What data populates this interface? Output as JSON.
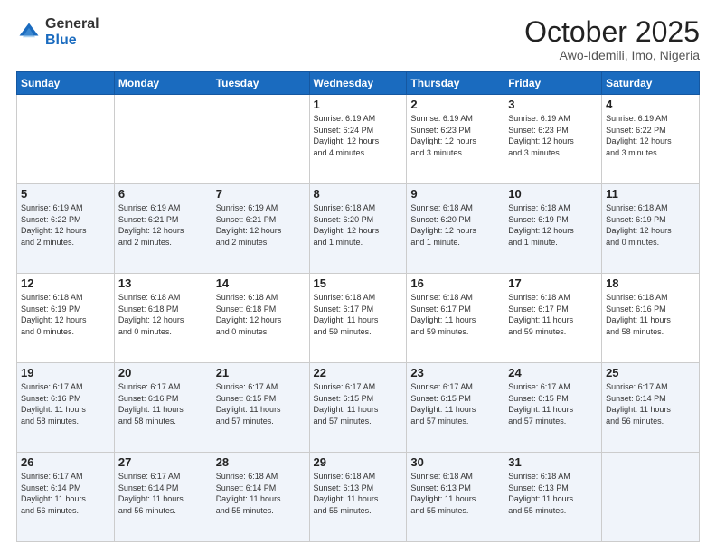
{
  "logo": {
    "general": "General",
    "blue": "Blue"
  },
  "header": {
    "month": "October 2025",
    "location": "Awo-Idemili, Imo, Nigeria"
  },
  "days_of_week": [
    "Sunday",
    "Monday",
    "Tuesday",
    "Wednesday",
    "Thursday",
    "Friday",
    "Saturday"
  ],
  "weeks": [
    [
      {
        "day": "",
        "info": ""
      },
      {
        "day": "",
        "info": ""
      },
      {
        "day": "",
        "info": ""
      },
      {
        "day": "1",
        "info": "Sunrise: 6:19 AM\nSunset: 6:24 PM\nDaylight: 12 hours\nand 4 minutes."
      },
      {
        "day": "2",
        "info": "Sunrise: 6:19 AM\nSunset: 6:23 PM\nDaylight: 12 hours\nand 3 minutes."
      },
      {
        "day": "3",
        "info": "Sunrise: 6:19 AM\nSunset: 6:23 PM\nDaylight: 12 hours\nand 3 minutes."
      },
      {
        "day": "4",
        "info": "Sunrise: 6:19 AM\nSunset: 6:22 PM\nDaylight: 12 hours\nand 3 minutes."
      }
    ],
    [
      {
        "day": "5",
        "info": "Sunrise: 6:19 AM\nSunset: 6:22 PM\nDaylight: 12 hours\nand 2 minutes."
      },
      {
        "day": "6",
        "info": "Sunrise: 6:19 AM\nSunset: 6:21 PM\nDaylight: 12 hours\nand 2 minutes."
      },
      {
        "day": "7",
        "info": "Sunrise: 6:19 AM\nSunset: 6:21 PM\nDaylight: 12 hours\nand 2 minutes."
      },
      {
        "day": "8",
        "info": "Sunrise: 6:18 AM\nSunset: 6:20 PM\nDaylight: 12 hours\nand 1 minute."
      },
      {
        "day": "9",
        "info": "Sunrise: 6:18 AM\nSunset: 6:20 PM\nDaylight: 12 hours\nand 1 minute."
      },
      {
        "day": "10",
        "info": "Sunrise: 6:18 AM\nSunset: 6:19 PM\nDaylight: 12 hours\nand 1 minute."
      },
      {
        "day": "11",
        "info": "Sunrise: 6:18 AM\nSunset: 6:19 PM\nDaylight: 12 hours\nand 0 minutes."
      }
    ],
    [
      {
        "day": "12",
        "info": "Sunrise: 6:18 AM\nSunset: 6:19 PM\nDaylight: 12 hours\nand 0 minutes."
      },
      {
        "day": "13",
        "info": "Sunrise: 6:18 AM\nSunset: 6:18 PM\nDaylight: 12 hours\nand 0 minutes."
      },
      {
        "day": "14",
        "info": "Sunrise: 6:18 AM\nSunset: 6:18 PM\nDaylight: 12 hours\nand 0 minutes."
      },
      {
        "day": "15",
        "info": "Sunrise: 6:18 AM\nSunset: 6:17 PM\nDaylight: 11 hours\nand 59 minutes."
      },
      {
        "day": "16",
        "info": "Sunrise: 6:18 AM\nSunset: 6:17 PM\nDaylight: 11 hours\nand 59 minutes."
      },
      {
        "day": "17",
        "info": "Sunrise: 6:18 AM\nSunset: 6:17 PM\nDaylight: 11 hours\nand 59 minutes."
      },
      {
        "day": "18",
        "info": "Sunrise: 6:18 AM\nSunset: 6:16 PM\nDaylight: 11 hours\nand 58 minutes."
      }
    ],
    [
      {
        "day": "19",
        "info": "Sunrise: 6:17 AM\nSunset: 6:16 PM\nDaylight: 11 hours\nand 58 minutes."
      },
      {
        "day": "20",
        "info": "Sunrise: 6:17 AM\nSunset: 6:16 PM\nDaylight: 11 hours\nand 58 minutes."
      },
      {
        "day": "21",
        "info": "Sunrise: 6:17 AM\nSunset: 6:15 PM\nDaylight: 11 hours\nand 57 minutes."
      },
      {
        "day": "22",
        "info": "Sunrise: 6:17 AM\nSunset: 6:15 PM\nDaylight: 11 hours\nand 57 minutes."
      },
      {
        "day": "23",
        "info": "Sunrise: 6:17 AM\nSunset: 6:15 PM\nDaylight: 11 hours\nand 57 minutes."
      },
      {
        "day": "24",
        "info": "Sunrise: 6:17 AM\nSunset: 6:15 PM\nDaylight: 11 hours\nand 57 minutes."
      },
      {
        "day": "25",
        "info": "Sunrise: 6:17 AM\nSunset: 6:14 PM\nDaylight: 11 hours\nand 56 minutes."
      }
    ],
    [
      {
        "day": "26",
        "info": "Sunrise: 6:17 AM\nSunset: 6:14 PM\nDaylight: 11 hours\nand 56 minutes."
      },
      {
        "day": "27",
        "info": "Sunrise: 6:17 AM\nSunset: 6:14 PM\nDaylight: 11 hours\nand 56 minutes."
      },
      {
        "day": "28",
        "info": "Sunrise: 6:18 AM\nSunset: 6:14 PM\nDaylight: 11 hours\nand 55 minutes."
      },
      {
        "day": "29",
        "info": "Sunrise: 6:18 AM\nSunset: 6:13 PM\nDaylight: 11 hours\nand 55 minutes."
      },
      {
        "day": "30",
        "info": "Sunrise: 6:18 AM\nSunset: 6:13 PM\nDaylight: 11 hours\nand 55 minutes."
      },
      {
        "day": "31",
        "info": "Sunrise: 6:18 AM\nSunset: 6:13 PM\nDaylight: 11 hours\nand 55 minutes."
      },
      {
        "day": "",
        "info": ""
      }
    ]
  ]
}
